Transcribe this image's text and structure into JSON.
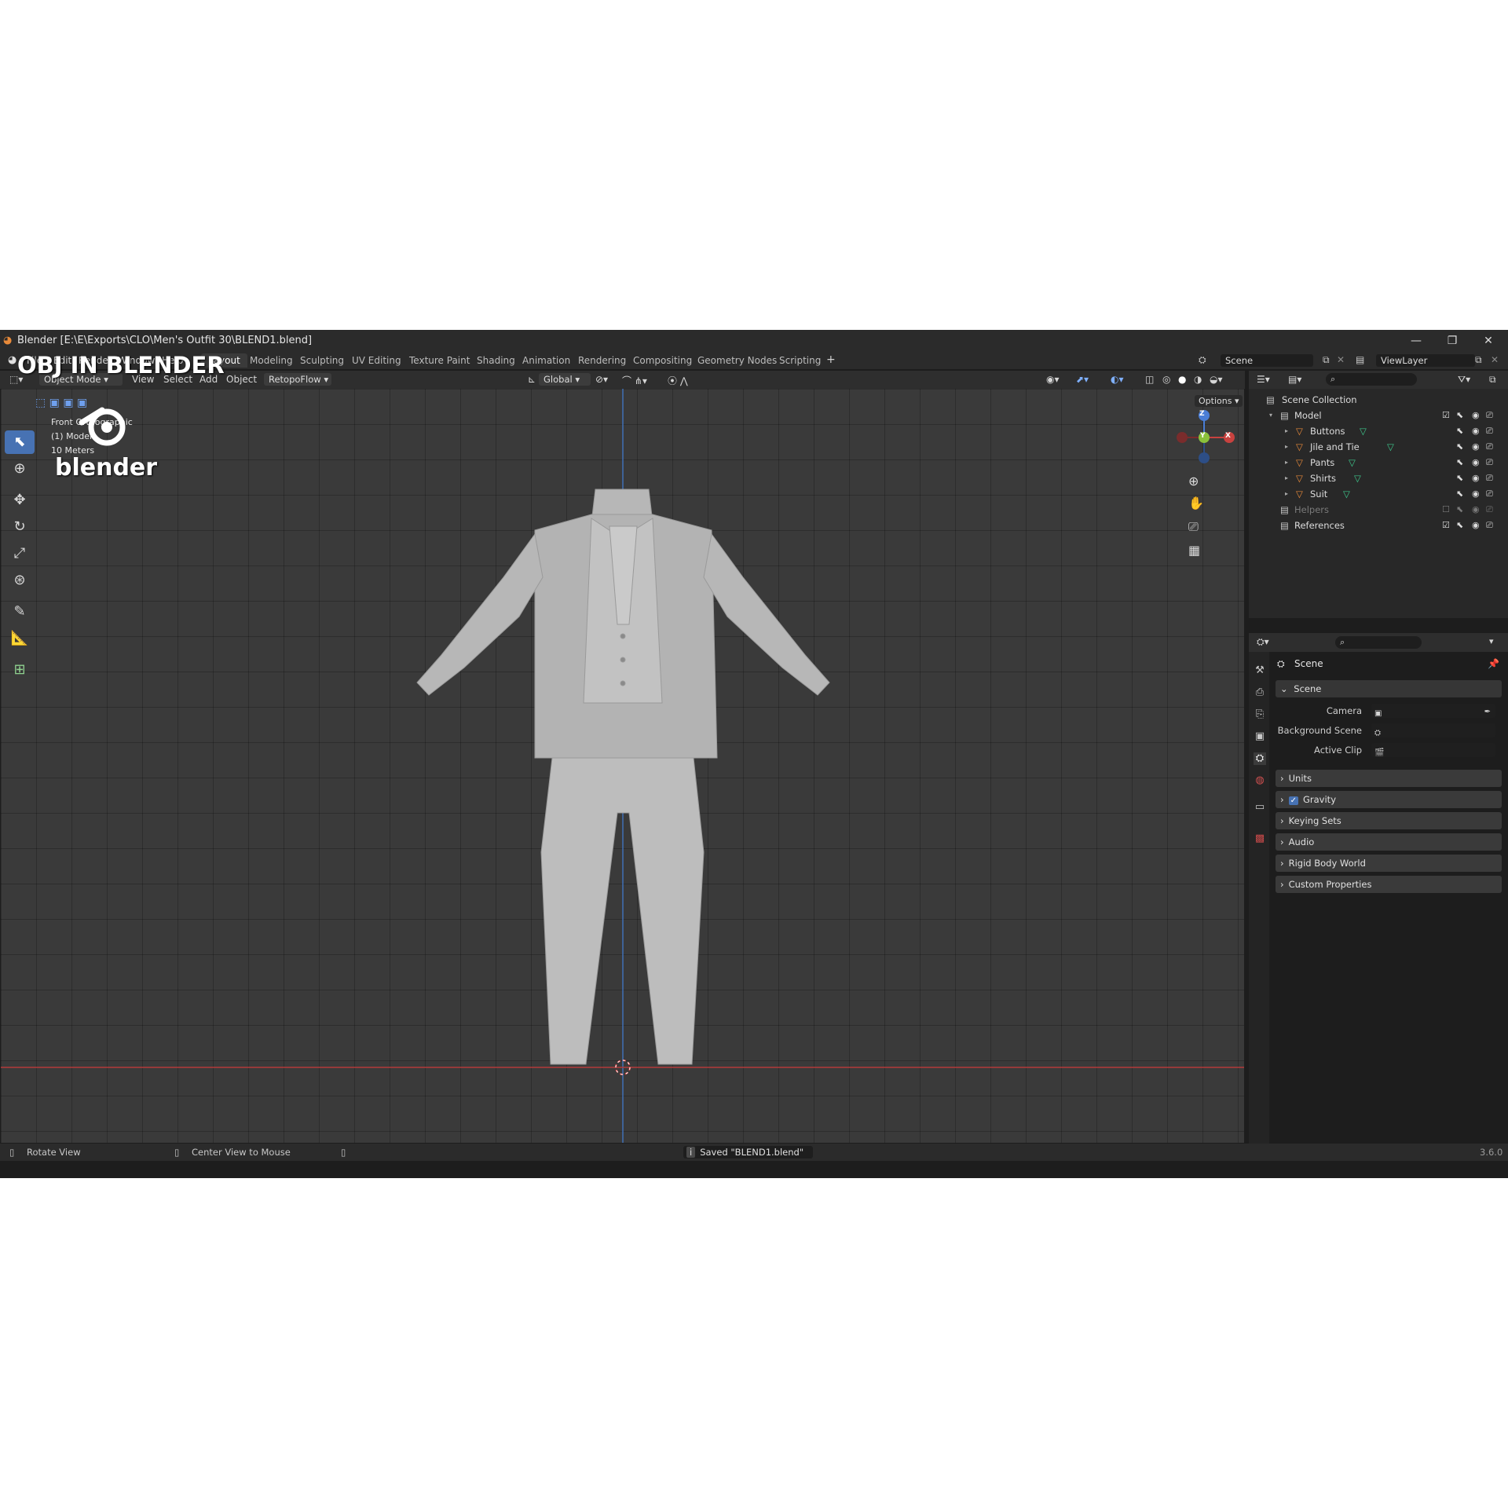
{
  "window": {
    "title": "Blender [E:\\E\\Exports\\CLO\\Men's Outfit 30\\BLEND1.blend]",
    "overlay_text": "OBJ IN BLENDER",
    "logo_text": "blender"
  },
  "menu": [
    "File",
    "Edit",
    "Render",
    "Window",
    "Help"
  ],
  "workspace_tabs": [
    "Layout",
    "Modeling",
    "Sculpting",
    "UV Editing",
    "Texture Paint",
    "Shading",
    "Animation",
    "Rendering",
    "Compositing",
    "Geometry Nodes",
    "Scripting"
  ],
  "active_tab": "Layout",
  "scene_field": "Scene",
  "viewlayer_field": "ViewLayer",
  "viewport_header": {
    "mode": "Object Mode",
    "items": [
      "View",
      "Select",
      "Add",
      "Object"
    ],
    "addon": "RetopoFlow",
    "orientation": "Global",
    "options": "Options"
  },
  "viewport_info": [
    "Front Orthographic",
    "(1) Model",
    "10 Meters"
  ],
  "gizmo": {
    "z": "Z",
    "y": "Y",
    "x": "X"
  },
  "outliner": {
    "root": "Scene Collection",
    "rows": [
      {
        "label": "Model",
        "indent": 0,
        "kind": "collection",
        "enabled": true
      },
      {
        "label": "Buttons",
        "indent": 1,
        "kind": "object",
        "enabled": true
      },
      {
        "label": "Jile and Tie",
        "indent": 1,
        "kind": "object",
        "enabled": true
      },
      {
        "label": "Pants",
        "indent": 1,
        "kind": "object",
        "enabled": true
      },
      {
        "label": "Shirts",
        "indent": 1,
        "kind": "object",
        "enabled": true
      },
      {
        "label": "Suit",
        "indent": 1,
        "kind": "object",
        "enabled": true
      },
      {
        "label": "Helpers",
        "indent": 0,
        "kind": "collection",
        "enabled": false
      },
      {
        "label": "References",
        "indent": 0,
        "kind": "collection",
        "enabled": true
      }
    ]
  },
  "properties": {
    "context": "Scene",
    "section": "Scene",
    "fields": [
      {
        "label": "Camera"
      },
      {
        "label": "Background Scene"
      },
      {
        "label": "Active Clip"
      }
    ],
    "panels": [
      "Units",
      "Gravity",
      "Keying Sets",
      "Audio",
      "Rigid Body World",
      "Custom Properties"
    ],
    "gravity_checked": true
  },
  "status": {
    "left": "Rotate View",
    "middle": "Center View to Mouse",
    "message": "Saved \"BLEND1.blend\"",
    "version": "3.6.0"
  },
  "colors": {
    "accent": "#4772b3",
    "x_axis": "#c8423f",
    "y_axis": "#8ac13b",
    "z_axis": "#4a7ed6",
    "object_icon": "#e88a3a",
    "mesh_icon": "#3ec98d"
  }
}
